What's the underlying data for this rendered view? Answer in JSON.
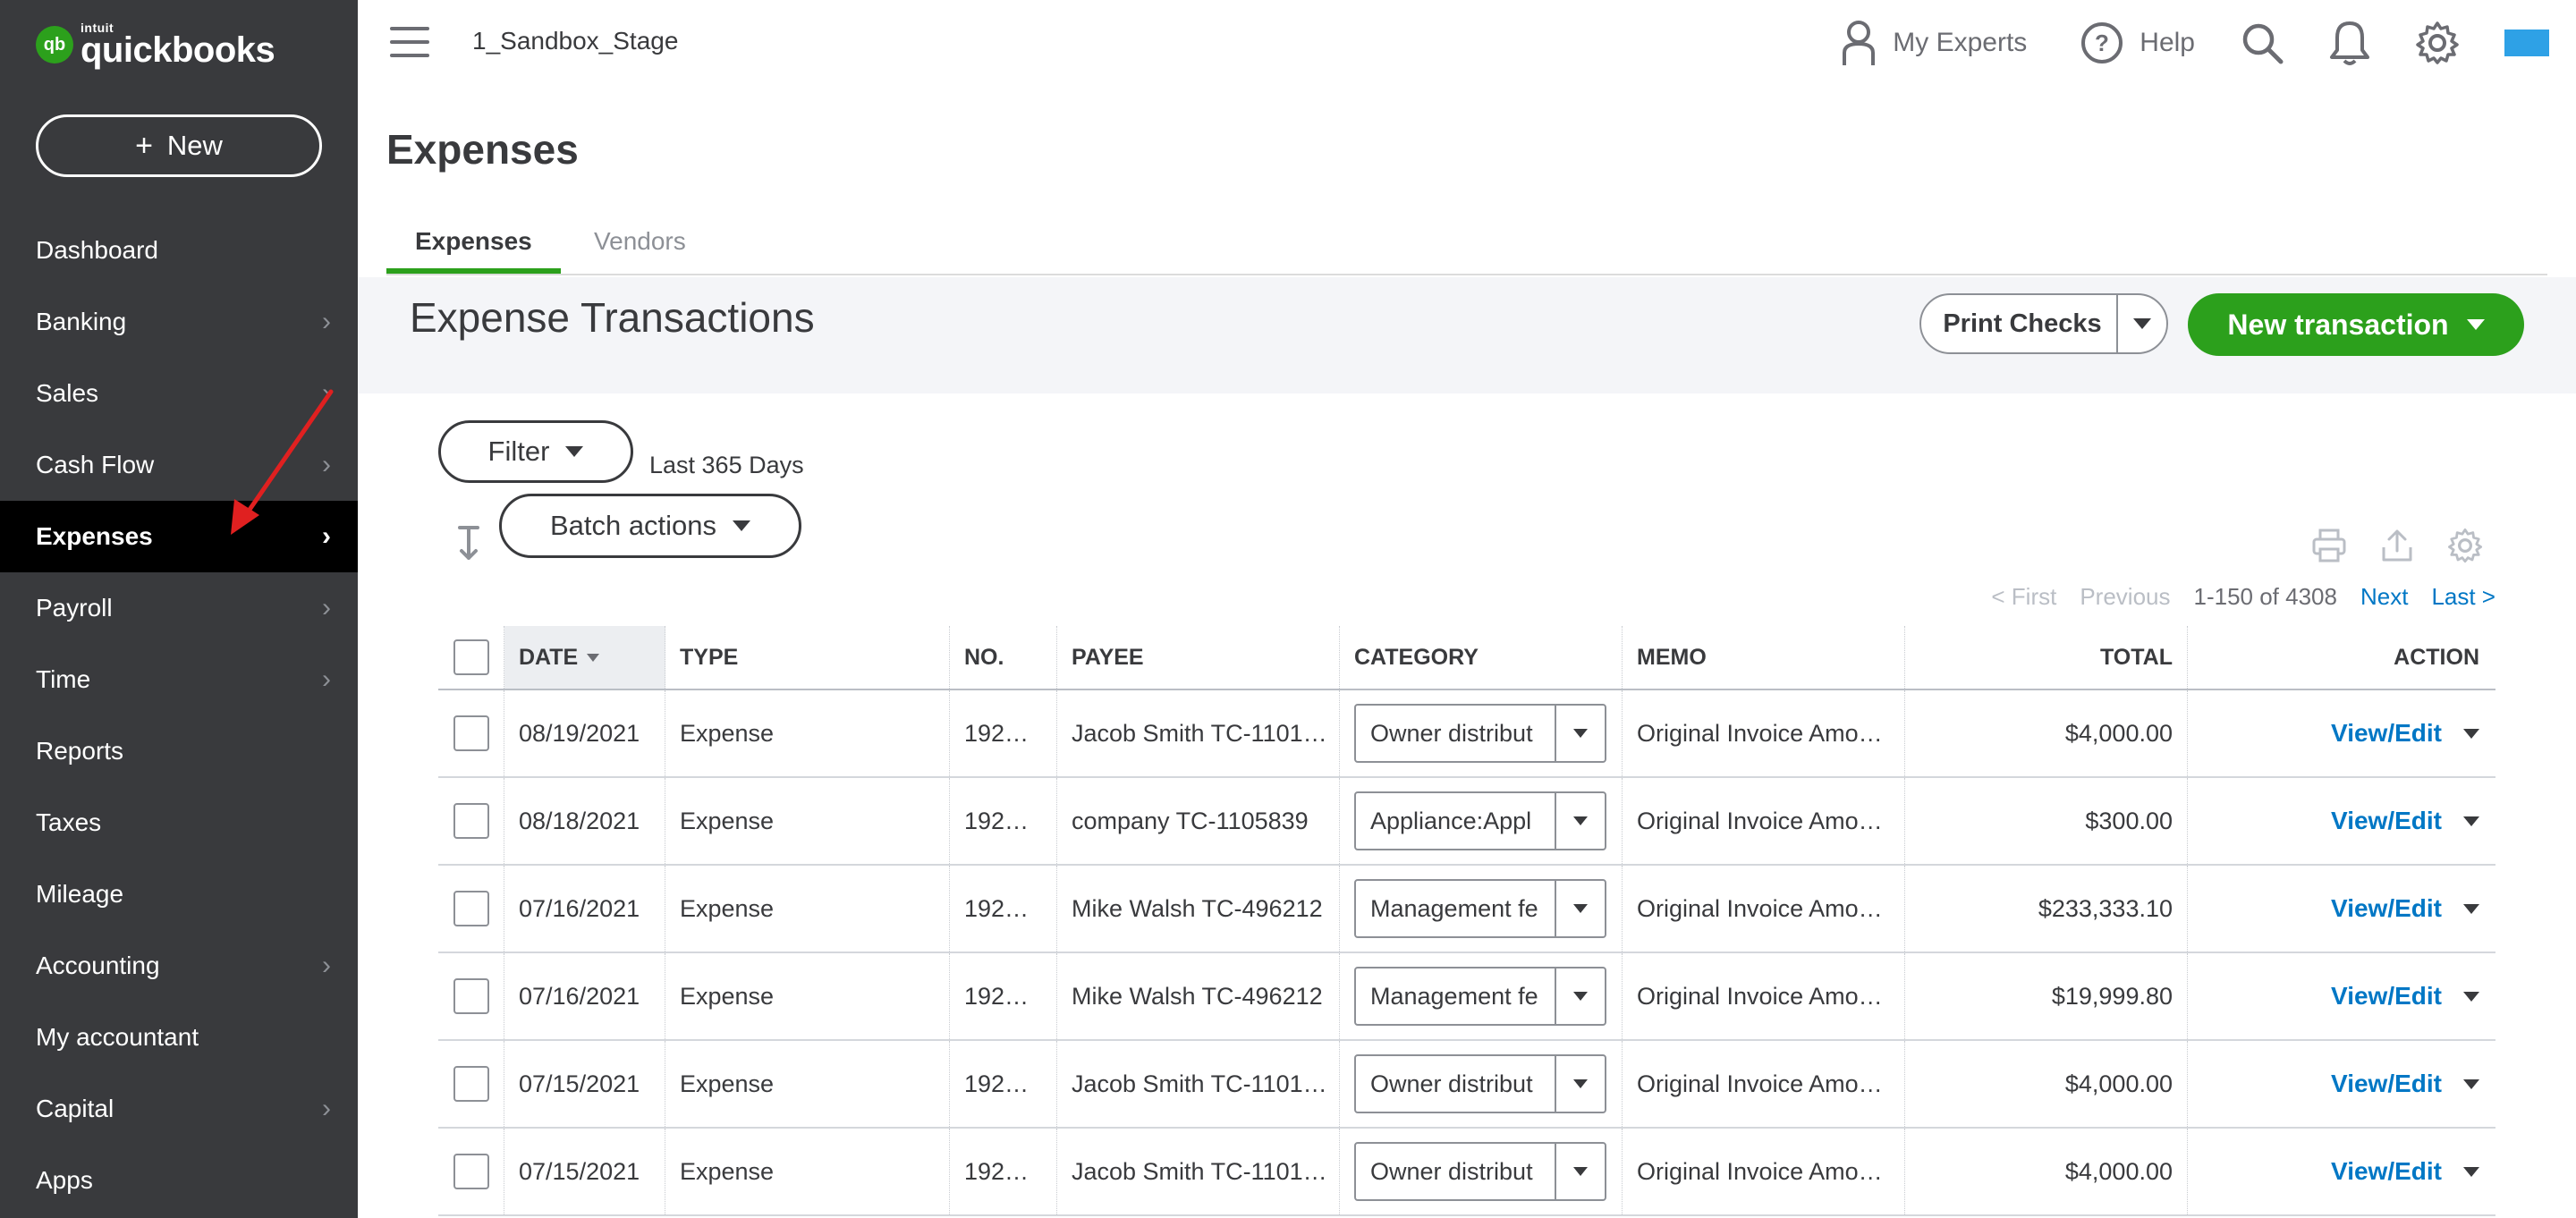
{
  "brand": {
    "mark": "qb",
    "intuit": "intuit",
    "name": "quickbooks",
    "color": "#2ca01c"
  },
  "sidebar": {
    "new_label": "New",
    "items": [
      {
        "label": "Dashboard",
        "chevron": false
      },
      {
        "label": "Banking",
        "chevron": true
      },
      {
        "label": "Sales",
        "chevron": true
      },
      {
        "label": "Cash Flow",
        "chevron": true
      },
      {
        "label": "Expenses",
        "chevron": true,
        "active": true
      },
      {
        "label": "Payroll",
        "chevron": true
      },
      {
        "label": "Time",
        "chevron": true
      },
      {
        "label": "Reports",
        "chevron": false
      },
      {
        "label": "Taxes",
        "chevron": false
      },
      {
        "label": "Mileage",
        "chevron": false
      },
      {
        "label": "Accounting",
        "chevron": true
      },
      {
        "label": "My accountant",
        "chevron": false
      },
      {
        "label": "Capital",
        "chevron": true
      },
      {
        "label": "Apps",
        "chevron": false
      }
    ]
  },
  "topbar": {
    "company": "1_Sandbox_Stage",
    "my_experts": "My Experts",
    "help": "Help"
  },
  "page": {
    "title": "Expenses",
    "tabs": [
      {
        "label": "Expenses",
        "active": true
      },
      {
        "label": "Vendors",
        "active": false
      }
    ]
  },
  "banner": {
    "title": "Expense Transactions",
    "print_checks": "Print Checks",
    "new_transaction": "New transaction"
  },
  "filters": {
    "filter_label": "Filter",
    "range": "Last 365 Days",
    "batch_label": "Batch actions"
  },
  "pager": {
    "first": "< First",
    "previous": "Previous",
    "range": "1-150 of 4308",
    "next": "Next",
    "last": "Last >"
  },
  "table": {
    "headers": {
      "date": "DATE",
      "type": "TYPE",
      "no": "NO.",
      "payee": "PAYEE",
      "category": "CATEGORY",
      "memo": "MEMO",
      "total": "TOTAL",
      "action": "ACTION"
    },
    "rows": [
      {
        "date": "08/19/2021",
        "type": "Expense",
        "no": "192…",
        "payee": "Jacob Smith TC-1101…",
        "category": "Owner distribut",
        "memo": "Original Invoice Amo…",
        "total": "$4,000.00",
        "action": "View/Edit"
      },
      {
        "date": "08/18/2021",
        "type": "Expense",
        "no": "192…",
        "payee": "company TC-1105839",
        "category": "Appliance:Appl",
        "memo": "Original Invoice Amo…",
        "total": "$300.00",
        "action": "View/Edit"
      },
      {
        "date": "07/16/2021",
        "type": "Expense",
        "no": "192…",
        "payee": "Mike Walsh TC-496212",
        "category": "Management fe",
        "memo": "Original Invoice Amo…",
        "total": "$233,333.10",
        "action": "View/Edit"
      },
      {
        "date": "07/16/2021",
        "type": "Expense",
        "no": "192…",
        "payee": "Mike Walsh TC-496212",
        "category": "Management fe",
        "memo": "Original Invoice Amo…",
        "total": "$19,999.80",
        "action": "View/Edit"
      },
      {
        "date": "07/15/2021",
        "type": "Expense",
        "no": "192…",
        "payee": "Jacob Smith TC-1101…",
        "category": "Owner distribut",
        "memo": "Original Invoice Amo…",
        "total": "$4,000.00",
        "action": "View/Edit"
      },
      {
        "date": "07/15/2021",
        "type": "Expense",
        "no": "192…",
        "payee": "Jacob Smith TC-1101…",
        "category": "Owner distribut",
        "memo": "Original Invoice Amo…",
        "total": "$4,000.00",
        "action": "View/Edit"
      }
    ]
  },
  "colors": {
    "sidebar": "#393a3d",
    "active": "#000000",
    "link": "#0077c5",
    "primary": "#2ca01c",
    "annotation": "#e02020"
  }
}
